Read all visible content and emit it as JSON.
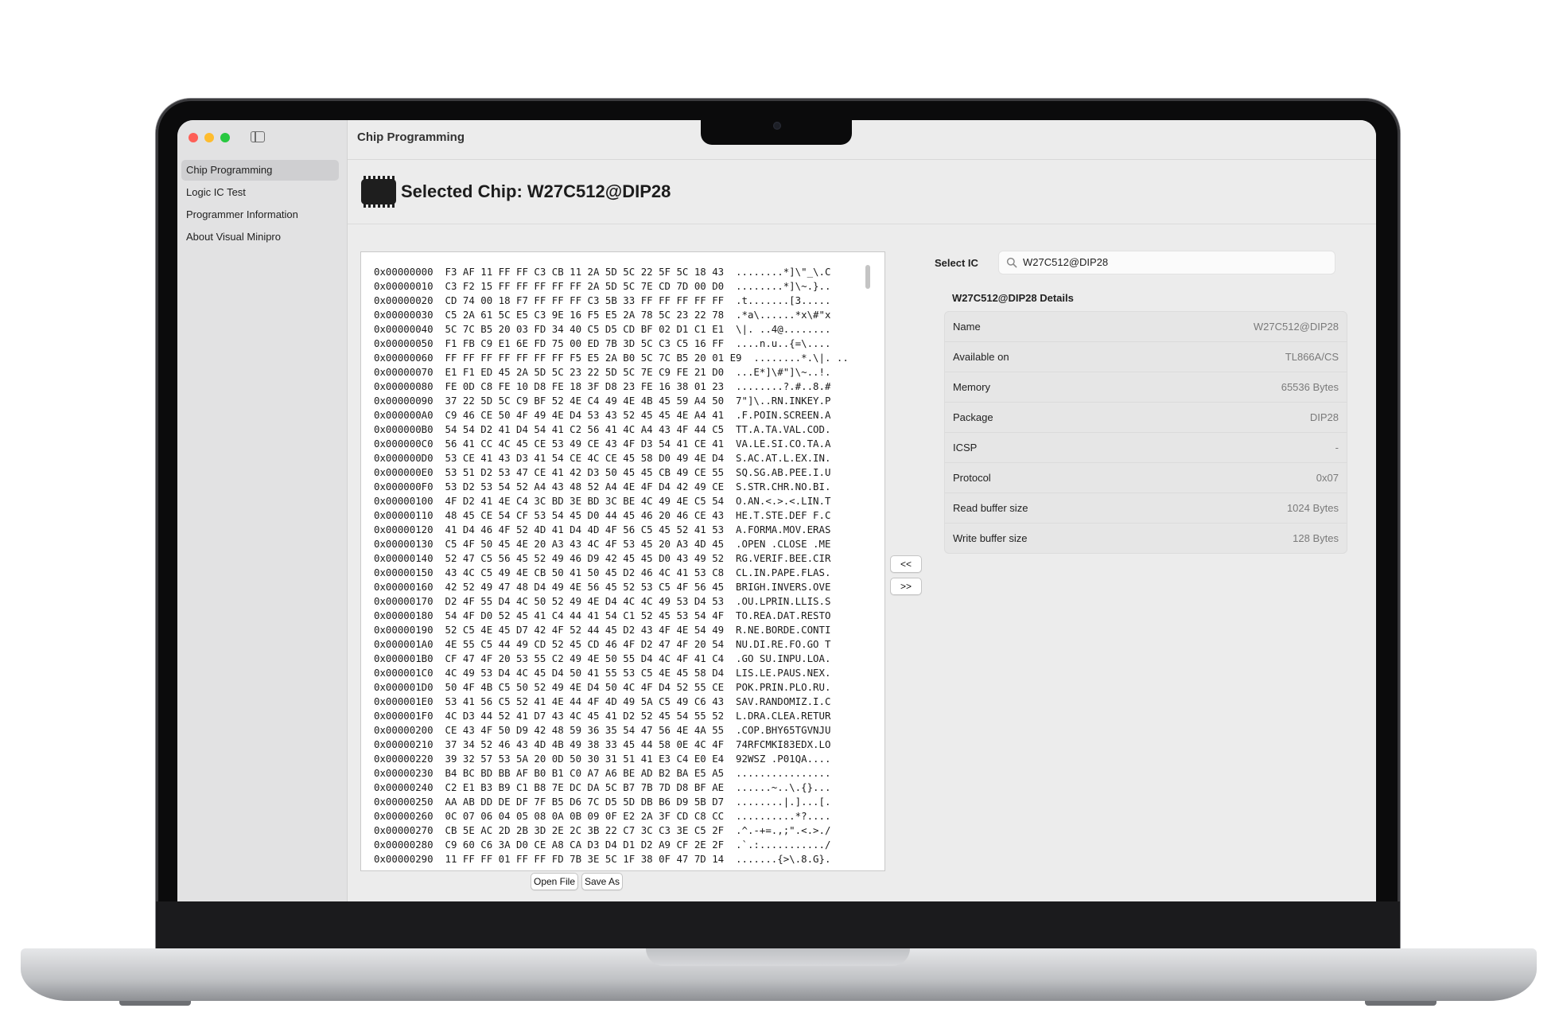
{
  "window": {
    "title": "Chip Programming"
  },
  "sidebar": {
    "items": [
      {
        "label": "Chip Programming",
        "active": true
      },
      {
        "label": "Logic IC Test",
        "active": false
      },
      {
        "label": "Programmer Information",
        "active": false
      },
      {
        "label": "About Visual Minipro",
        "active": false
      }
    ]
  },
  "header": {
    "heading": "Selected Chip: W27C512@DIP28"
  },
  "hex": {
    "lines": [
      "0x00000000  F3 AF 11 FF FF C3 CB 11 2A 5D 5C 22 5F 5C 18 43  ........*]\\\"_\\.C",
      "0x00000010  C3 F2 15 FF FF FF FF FF 2A 5D 5C 7E CD 7D 00 D0  ........*]\\~.}..",
      "0x00000020  CD 74 00 18 F7 FF FF FF C3 5B 33 FF FF FF FF FF  .t.......[3.....",
      "0x00000030  C5 2A 61 5C E5 C3 9E 16 F5 E5 2A 78 5C 23 22 78  .*a\\......*x\\#\"x",
      "0x00000040  5C 7C B5 20 03 FD 34 40 C5 D5 CD BF 02 D1 C1 E1  \\|. ..4@........",
      "0x00000050  F1 FB C9 E1 6E FD 75 00 ED 7B 3D 5C C3 C5 16 FF  ....n.u..{=\\....",
      "0x00000060  FF FF FF FF FF FF FF F5 E5 2A B0 5C 7C B5 20 01 E9  ........*.\\|. ..",
      "0x00000070  E1 F1 ED 45 2A 5D 5C 23 22 5D 5C 7E C9 FE 21 D0  ...E*]\\#\"]\\~..!.",
      "0x00000080  FE 0D C8 FE 10 D8 FE 18 3F D8 23 FE 16 38 01 23  ........?.#..8.#",
      "0x00000090  37 22 5D 5C C9 BF 52 4E C4 49 4E 4B 45 59 A4 50  7\"]\\..RN.INKEY.P",
      "0x000000A0  C9 46 CE 50 4F 49 4E D4 53 43 52 45 45 4E A4 41  .F.POIN.SCREEN.A",
      "0x000000B0  54 54 D2 41 D4 54 41 C2 56 41 4C A4 43 4F 44 C5  TT.A.TA.VAL.COD.",
      "0x000000C0  56 41 CC 4C 45 CE 53 49 CE 43 4F D3 54 41 CE 41  VA.LE.SI.CO.TA.A",
      "0x000000D0  53 CE 41 43 D3 41 54 CE 4C CE 45 58 D0 49 4E D4  S.AC.AT.L.EX.IN.",
      "0x000000E0  53 51 D2 53 47 CE 41 42 D3 50 45 45 CB 49 CE 55  SQ.SG.AB.PEE.I.U",
      "0x000000F0  53 D2 53 54 52 A4 43 48 52 A4 4E 4F D4 42 49 CE  S.STR.CHR.NO.BI.",
      "0x00000100  4F D2 41 4E C4 3C BD 3E BD 3C BE 4C 49 4E C5 54  O.AN.<.>.<.LIN.T",
      "0x00000110  48 45 CE 54 CF 53 54 45 D0 44 45 46 20 46 CE 43  HE.T.STE.DEF F.C",
      "0x00000120  41 D4 46 4F 52 4D 41 D4 4D 4F 56 C5 45 52 41 53  A.FORMA.MOV.ERAS",
      "0x00000130  C5 4F 50 45 4E 20 A3 43 4C 4F 53 45 20 A3 4D 45  .OPEN .CLOSE .ME",
      "0x00000140  52 47 C5 56 45 52 49 46 D9 42 45 45 D0 43 49 52  RG.VERIF.BEE.CIR",
      "0x00000150  43 4C C5 49 4E CB 50 41 50 45 D2 46 4C 41 53 C8  CL.IN.PAPE.FLAS.",
      "0x00000160  42 52 49 47 48 D4 49 4E 56 45 52 53 C5 4F 56 45  BRIGH.INVERS.OVE",
      "0x00000170  D2 4F 55 D4 4C 50 52 49 4E D4 4C 4C 49 53 D4 53  .OU.LPRIN.LLIS.S",
      "0x00000180  54 4F D0 52 45 41 C4 44 41 54 C1 52 45 53 54 4F  TO.REA.DAT.RESTO",
      "0x00000190  52 C5 4E 45 D7 42 4F 52 44 45 D2 43 4F 4E 54 49  R.NE.BORDE.CONTI",
      "0x000001A0  4E 55 C5 44 49 CD 52 45 CD 46 4F D2 47 4F 20 54  NU.DI.RE.FO.GO T",
      "0x000001B0  CF 47 4F 20 53 55 C2 49 4E 50 55 D4 4C 4F 41 C4  .GO SU.INPU.LOA.",
      "0x000001C0  4C 49 53 D4 4C 45 D4 50 41 55 53 C5 4E 45 58 D4  LIS.LE.PAUS.NEX.",
      "0x000001D0  50 4F 4B C5 50 52 49 4E D4 50 4C 4F D4 52 55 CE  POK.PRIN.PLO.RU.",
      "0x000001E0  53 41 56 C5 52 41 4E 44 4F 4D 49 5A C5 49 C6 43  SAV.RANDOMIZ.I.C",
      "0x000001F0  4C D3 44 52 41 D7 43 4C 45 41 D2 52 45 54 55 52  L.DRA.CLEA.RETUR",
      "0x00000200  CE 43 4F 50 D9 42 48 59 36 35 54 47 56 4E 4A 55  .COP.BHY65TGVNJU",
      "0x00000210  37 34 52 46 43 4D 4B 49 38 33 45 44 58 0E 4C 4F  74RFCMKI83EDX.LO",
      "0x00000220  39 32 57 53 5A 20 0D 50 30 31 51 41 E3 C4 E0 E4  92WSZ .P01QA....",
      "0x00000230  B4 BC BD BB AF B0 B1 C0 A7 A6 BE AD B2 BA E5 A5  ................",
      "0x00000240  C2 E1 B3 B9 C1 B8 7E DC DA 5C B7 7B 7D D8 BF AE  ......~..\\.{}...",
      "0x00000250  AA AB DD DE DF 7F B5 D6 7C D5 5D DB B6 D9 5B D7  ........|.]...[.",
      "0x00000260  0C 07 06 04 05 08 0A 0B 09 0F E2 2A 3F CD C8 CC  ..........*?....",
      "0x00000270  CB 5E AC 2D 2B 3D 2E 2C 3B 22 C7 3C C3 3E C5 2F  .^.-+=.,;\".<.>./",
      "0x00000280  C9 60 C6 3A D0 CE A8 CA D3 D4 D1 D2 A9 CF 2E 2F  .`.:.........../",
      "0x00000290  11 FF FF 01 FF FF FD 7B 3E 5C 1F 38 0F 47 7D 14  .......{>\\.8.G}."
    ],
    "open_label": "Open File",
    "save_label": "Save As",
    "prev_label": "<<",
    "next_label": ">>"
  },
  "select_ic": {
    "label": "Select IC",
    "value": "W27C512@DIP28"
  },
  "details": {
    "title": "W27C512@DIP28 Details",
    "rows": [
      {
        "key": "Name",
        "value": "W27C512@DIP28"
      },
      {
        "key": "Available on",
        "value": "TL866A/CS"
      },
      {
        "key": "Memory",
        "value": "65536 Bytes"
      },
      {
        "key": "Package",
        "value": "DIP28"
      },
      {
        "key": "ICSP",
        "value": "-"
      },
      {
        "key": "Protocol",
        "value": "0x07"
      },
      {
        "key": "Read buffer size",
        "value": "1024 Bytes"
      },
      {
        "key": "Write buffer size",
        "value": "128 Bytes"
      }
    ]
  },
  "colors": {
    "close": "#fe5f57",
    "minimize": "#febc2e",
    "zoom": "#28c840",
    "sidebar_active": "#cfcfd1"
  }
}
